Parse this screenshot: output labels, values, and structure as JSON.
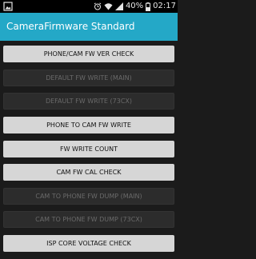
{
  "status_bar": {
    "notification_icon": "image-notification-icon",
    "icons": [
      "alarm-icon",
      "wifi-icon",
      "signal-icon"
    ],
    "battery_level": "40%",
    "battery_icon": "battery-icon",
    "time": "02:17"
  },
  "app_bar": {
    "title": "CameraFirmware Standard",
    "color": "#24a8c7"
  },
  "buttons": [
    {
      "label": "PHONE/CAM FW VER CHECK",
      "enabled": true
    },
    {
      "label": "DEFAULT FW WRITE (MAIN)",
      "enabled": false
    },
    {
      "label": "DEFAULT FW WRITE (73CX)",
      "enabled": false
    },
    {
      "label": "PHONE TO CAM FW WRITE",
      "enabled": true
    },
    {
      "label": "FW WRITE COUNT",
      "enabled": true
    },
    {
      "label": "CAM FW CAL CHECK",
      "enabled": true
    },
    {
      "label": "CAM TO PHONE FW DUMP (MAIN)",
      "enabled": false
    },
    {
      "label": "CAM TO PHONE FW DUMP (73CX)",
      "enabled": false
    },
    {
      "label": "ISP CORE VOLTAGE CHECK",
      "enabled": true
    }
  ]
}
